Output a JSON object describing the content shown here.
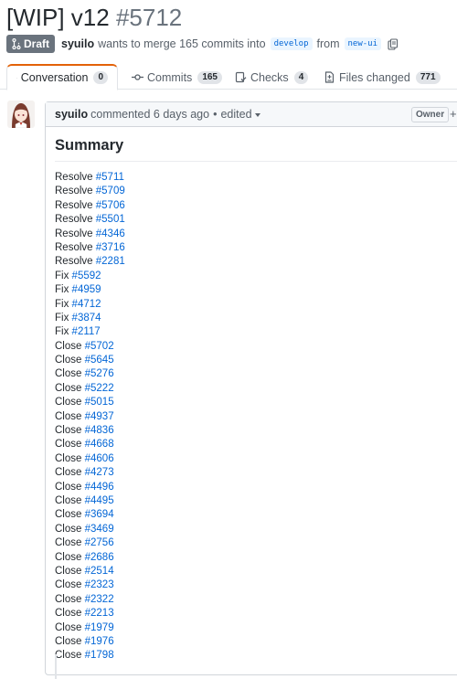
{
  "pr": {
    "title": "[WIP] v12",
    "number": "#5712",
    "status": "Draft",
    "author": "syuilo",
    "merge_text": "wants to merge 165 commits into",
    "base_branch": "develop",
    "from_text": "from",
    "head_branch": "new-ui"
  },
  "tabs": [
    {
      "label": "Conversation",
      "count": "0",
      "icon": "comment-icon",
      "active": true
    },
    {
      "label": "Commits",
      "count": "165",
      "icon": "commit-icon"
    },
    {
      "label": "Checks",
      "count": "4",
      "icon": "checklist-icon"
    },
    {
      "label": "Files changed",
      "count": "771",
      "icon": "file-diff-icon"
    }
  ],
  "comment": {
    "author": "syuilo",
    "action": "commented 6 days ago",
    "separator": "•",
    "edited": "edited",
    "role_badge": "Owner",
    "add_label": "+",
    "heading": "Summary"
  },
  "issues": [
    {
      "verb": "Resolve",
      "ref": "#5711"
    },
    {
      "verb": "Resolve",
      "ref": "#5709"
    },
    {
      "verb": "Resolve",
      "ref": "#5706"
    },
    {
      "verb": "Resolve",
      "ref": "#5501"
    },
    {
      "verb": "Resolve",
      "ref": "#4346"
    },
    {
      "verb": "Resolve",
      "ref": "#3716"
    },
    {
      "verb": "Resolve",
      "ref": "#2281"
    },
    {
      "verb": "Fix",
      "ref": "#5592"
    },
    {
      "verb": "Fix",
      "ref": "#4959"
    },
    {
      "verb": "Fix",
      "ref": "#4712"
    },
    {
      "verb": "Fix",
      "ref": "#3874"
    },
    {
      "verb": "Fix",
      "ref": "#2117"
    },
    {
      "verb": "Close",
      "ref": "#5702"
    },
    {
      "verb": "Close",
      "ref": "#5645"
    },
    {
      "verb": "Close",
      "ref": "#5276"
    },
    {
      "verb": "Close",
      "ref": "#5222"
    },
    {
      "verb": "Close",
      "ref": "#5015"
    },
    {
      "verb": "Close",
      "ref": "#4937"
    },
    {
      "verb": "Close",
      "ref": "#4836"
    },
    {
      "verb": "Close",
      "ref": "#4668"
    },
    {
      "verb": "Close",
      "ref": "#4606"
    },
    {
      "verb": "Close",
      "ref": "#4273"
    },
    {
      "verb": "Close",
      "ref": "#4496"
    },
    {
      "verb": "Close",
      "ref": "#4495"
    },
    {
      "verb": "Close",
      "ref": "#3694"
    },
    {
      "verb": "Close",
      "ref": "#3469"
    },
    {
      "verb": "Close",
      "ref": "#2756"
    },
    {
      "verb": "Close",
      "ref": "#2686"
    },
    {
      "verb": "Close",
      "ref": "#2514"
    },
    {
      "verb": "Close",
      "ref": "#2323"
    },
    {
      "verb": "Close",
      "ref": "#2322"
    },
    {
      "verb": "Close",
      "ref": "#2213"
    },
    {
      "verb": "Close",
      "ref": "#1979"
    },
    {
      "verb": "Close",
      "ref": "#1976"
    },
    {
      "verb": "Close",
      "ref": "#1798"
    }
  ],
  "colors": {
    "link": "#0366d6",
    "draft_badge": "#6a737d",
    "active_tab_accent": "#e36209"
  }
}
